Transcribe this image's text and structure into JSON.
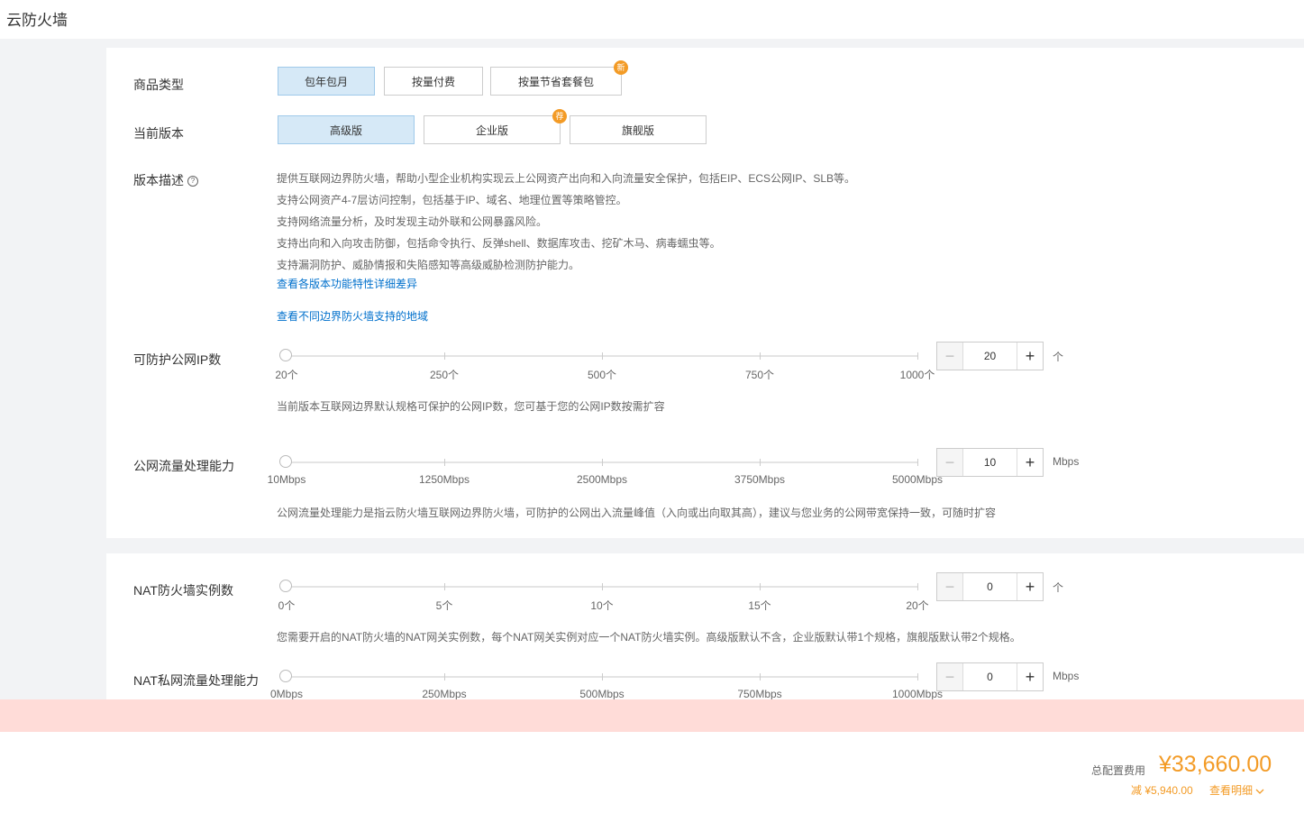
{
  "page": {
    "title": "云防火墙"
  },
  "product_type": {
    "label": "商品类型",
    "options": [
      "包年包月",
      "按量付费",
      "按量节省套餐包"
    ],
    "new_badge": "新"
  },
  "version": {
    "label": "当前版本",
    "options": [
      "高级版",
      "企业版",
      "旗舰版"
    ],
    "badge": "荐"
  },
  "description": {
    "label": "版本描述",
    "help": "?",
    "lines": [
      "提供互联网边界防火墙，帮助小型企业机构实现云上公网资产出向和入向流量安全保护，包括EIP、ECS公网IP、SLB等。",
      "支持公网资产4-7层访问控制，包括基于IP、域名、地理位置等策略管控。",
      "支持网络流量分析，及时发现主动外联和公网暴露风险。",
      "支持出向和入向攻击防御，包括命令执行、反弹shell、数据库攻击、挖矿木马、病毒蠕虫等。",
      "支持漏洞防护、威胁情报和失陷感知等高级威胁检测防护能力。"
    ],
    "link_features": "查看各版本功能特性详细差异",
    "link_regions": "查看不同边界防火墙支持的地域"
  },
  "public_ip": {
    "label": "可防护公网IP数",
    "ticks": [
      "20个",
      "250个",
      "500个",
      "750个",
      "1000个"
    ],
    "value": "20",
    "unit": "个",
    "hint": "当前版本互联网边界默认规格可保护的公网IP数，您可基于您的公网IP数按需扩容"
  },
  "public_traffic": {
    "label": "公网流量处理能力",
    "ticks": [
      "10Mbps",
      "1250Mbps",
      "2500Mbps",
      "3750Mbps",
      "5000Mbps"
    ],
    "value": "10",
    "unit": "Mbps",
    "hint": "公网流量处理能力是指云防火墙互联网边界防火墙，可防护的公网出入流量峰值（入向或出向取其高），建议与您业务的公网带宽保持一致，可随时扩容"
  },
  "nat_instances": {
    "label": "NAT防火墙实例数",
    "ticks": [
      "0个",
      "5个",
      "10个",
      "15个",
      "20个"
    ],
    "value": "0",
    "unit": "个",
    "hint": "您需要开启的NAT防火墙的NAT网关实例数，每个NAT网关实例对应一个NAT防火墙实例。高级版默认不含，企业版默认带1个规格，旗舰版默认带2个规格。"
  },
  "nat_traffic": {
    "label": "NAT私网流量处理能力",
    "ticks": [
      "0Mbps",
      "250Mbps",
      "500Mbps",
      "750Mbps",
      "1000Mbps"
    ],
    "value": "0",
    "unit": "Mbps"
  },
  "stepper": {
    "minus": "−",
    "plus": "+"
  },
  "summary": {
    "total_label": "总配置费用",
    "total_price": "¥33,660.00",
    "discount": "减 ¥5,940.00",
    "details": "查看明细"
  }
}
